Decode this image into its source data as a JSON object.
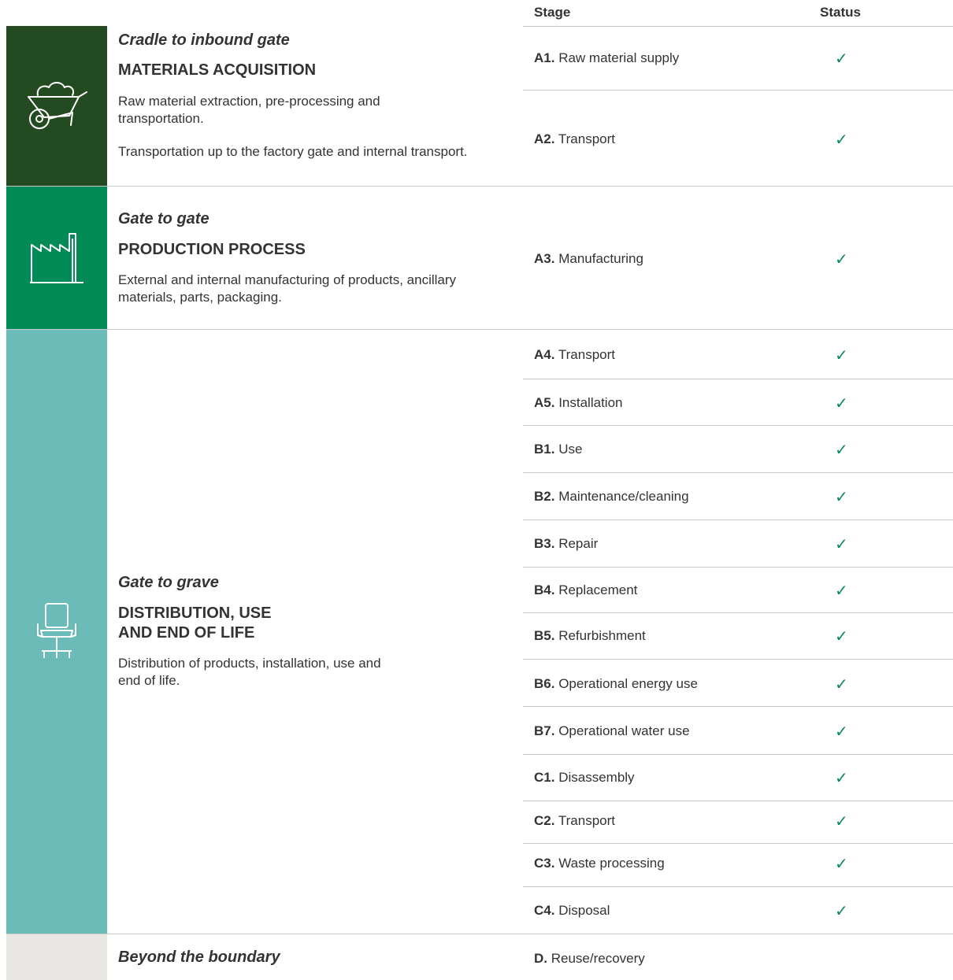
{
  "header": {
    "stage": "Stage",
    "status": "Status"
  },
  "sections": [
    {
      "subtitle": "Cradle to inbound gate",
      "title": [
        "MATERIALS ACQUISITION"
      ],
      "descriptions": [
        [
          "Raw material extraction, pre-processing and",
          "transportation."
        ],
        [
          "Transportation up to the factory gate and internal transport."
        ]
      ],
      "icon": "wheelbarrow-icon",
      "color": "#234a20"
    },
    {
      "subtitle": "Gate to gate",
      "title": [
        "PRODUCTION PROCESS"
      ],
      "descriptions": [
        [
          "External and internal manufacturing of products, ancillary",
          "materials, parts, packaging."
        ]
      ],
      "icon": "factory-icon",
      "color": "#028a57"
    },
    {
      "subtitle": "Gate to grave",
      "title": [
        "DISTRIBUTION, USE",
        "AND END OF LIFE"
      ],
      "descriptions": [
        [
          "Distribution of products, installation, use and",
          "end of life."
        ]
      ],
      "icon": "office-chair-icon",
      "color": "#6bbcb9"
    },
    {
      "subtitle": "Beyond the boundary",
      "icon": "",
      "color": "#e8e7e3"
    }
  ],
  "stages": [
    {
      "code": "A1.",
      "label": "Raw material supply",
      "status": "✓"
    },
    {
      "code": "A2.",
      "label": "Transport",
      "status": "✓"
    },
    {
      "code": "A3.",
      "label": "Manufacturing",
      "status": "✓"
    },
    {
      "code": "A4.",
      "label": "Transport",
      "status": "✓"
    },
    {
      "code": "A5.",
      "label": "Installation",
      "status": "✓"
    },
    {
      "code": "B1.",
      "label": "Use",
      "status": "✓"
    },
    {
      "code": "B2.",
      "label": "Maintenance/cleaning",
      "status": "✓"
    },
    {
      "code": "B3.",
      "label": "Repair",
      "status": "✓"
    },
    {
      "code": "B4.",
      "label": "Replacement",
      "status": "✓"
    },
    {
      "code": "B5.",
      "label": "Refurbishment",
      "status": "✓"
    },
    {
      "code": "B6.",
      "label": "Operational energy use",
      "status": "✓"
    },
    {
      "code": "B7.",
      "label": "Operational water use",
      "status": "✓"
    },
    {
      "code": "C1.",
      "label": "Disassembly",
      "status": "✓"
    },
    {
      "code": "C2.",
      "label": "Transport",
      "status": "✓"
    },
    {
      "code": "C3.",
      "label": "Waste processing",
      "status": "✓"
    },
    {
      "code": "C4.",
      "label": "Disposal",
      "status": "✓"
    },
    {
      "code": "D.",
      "label": "Reuse/recovery",
      "status": ""
    }
  ]
}
